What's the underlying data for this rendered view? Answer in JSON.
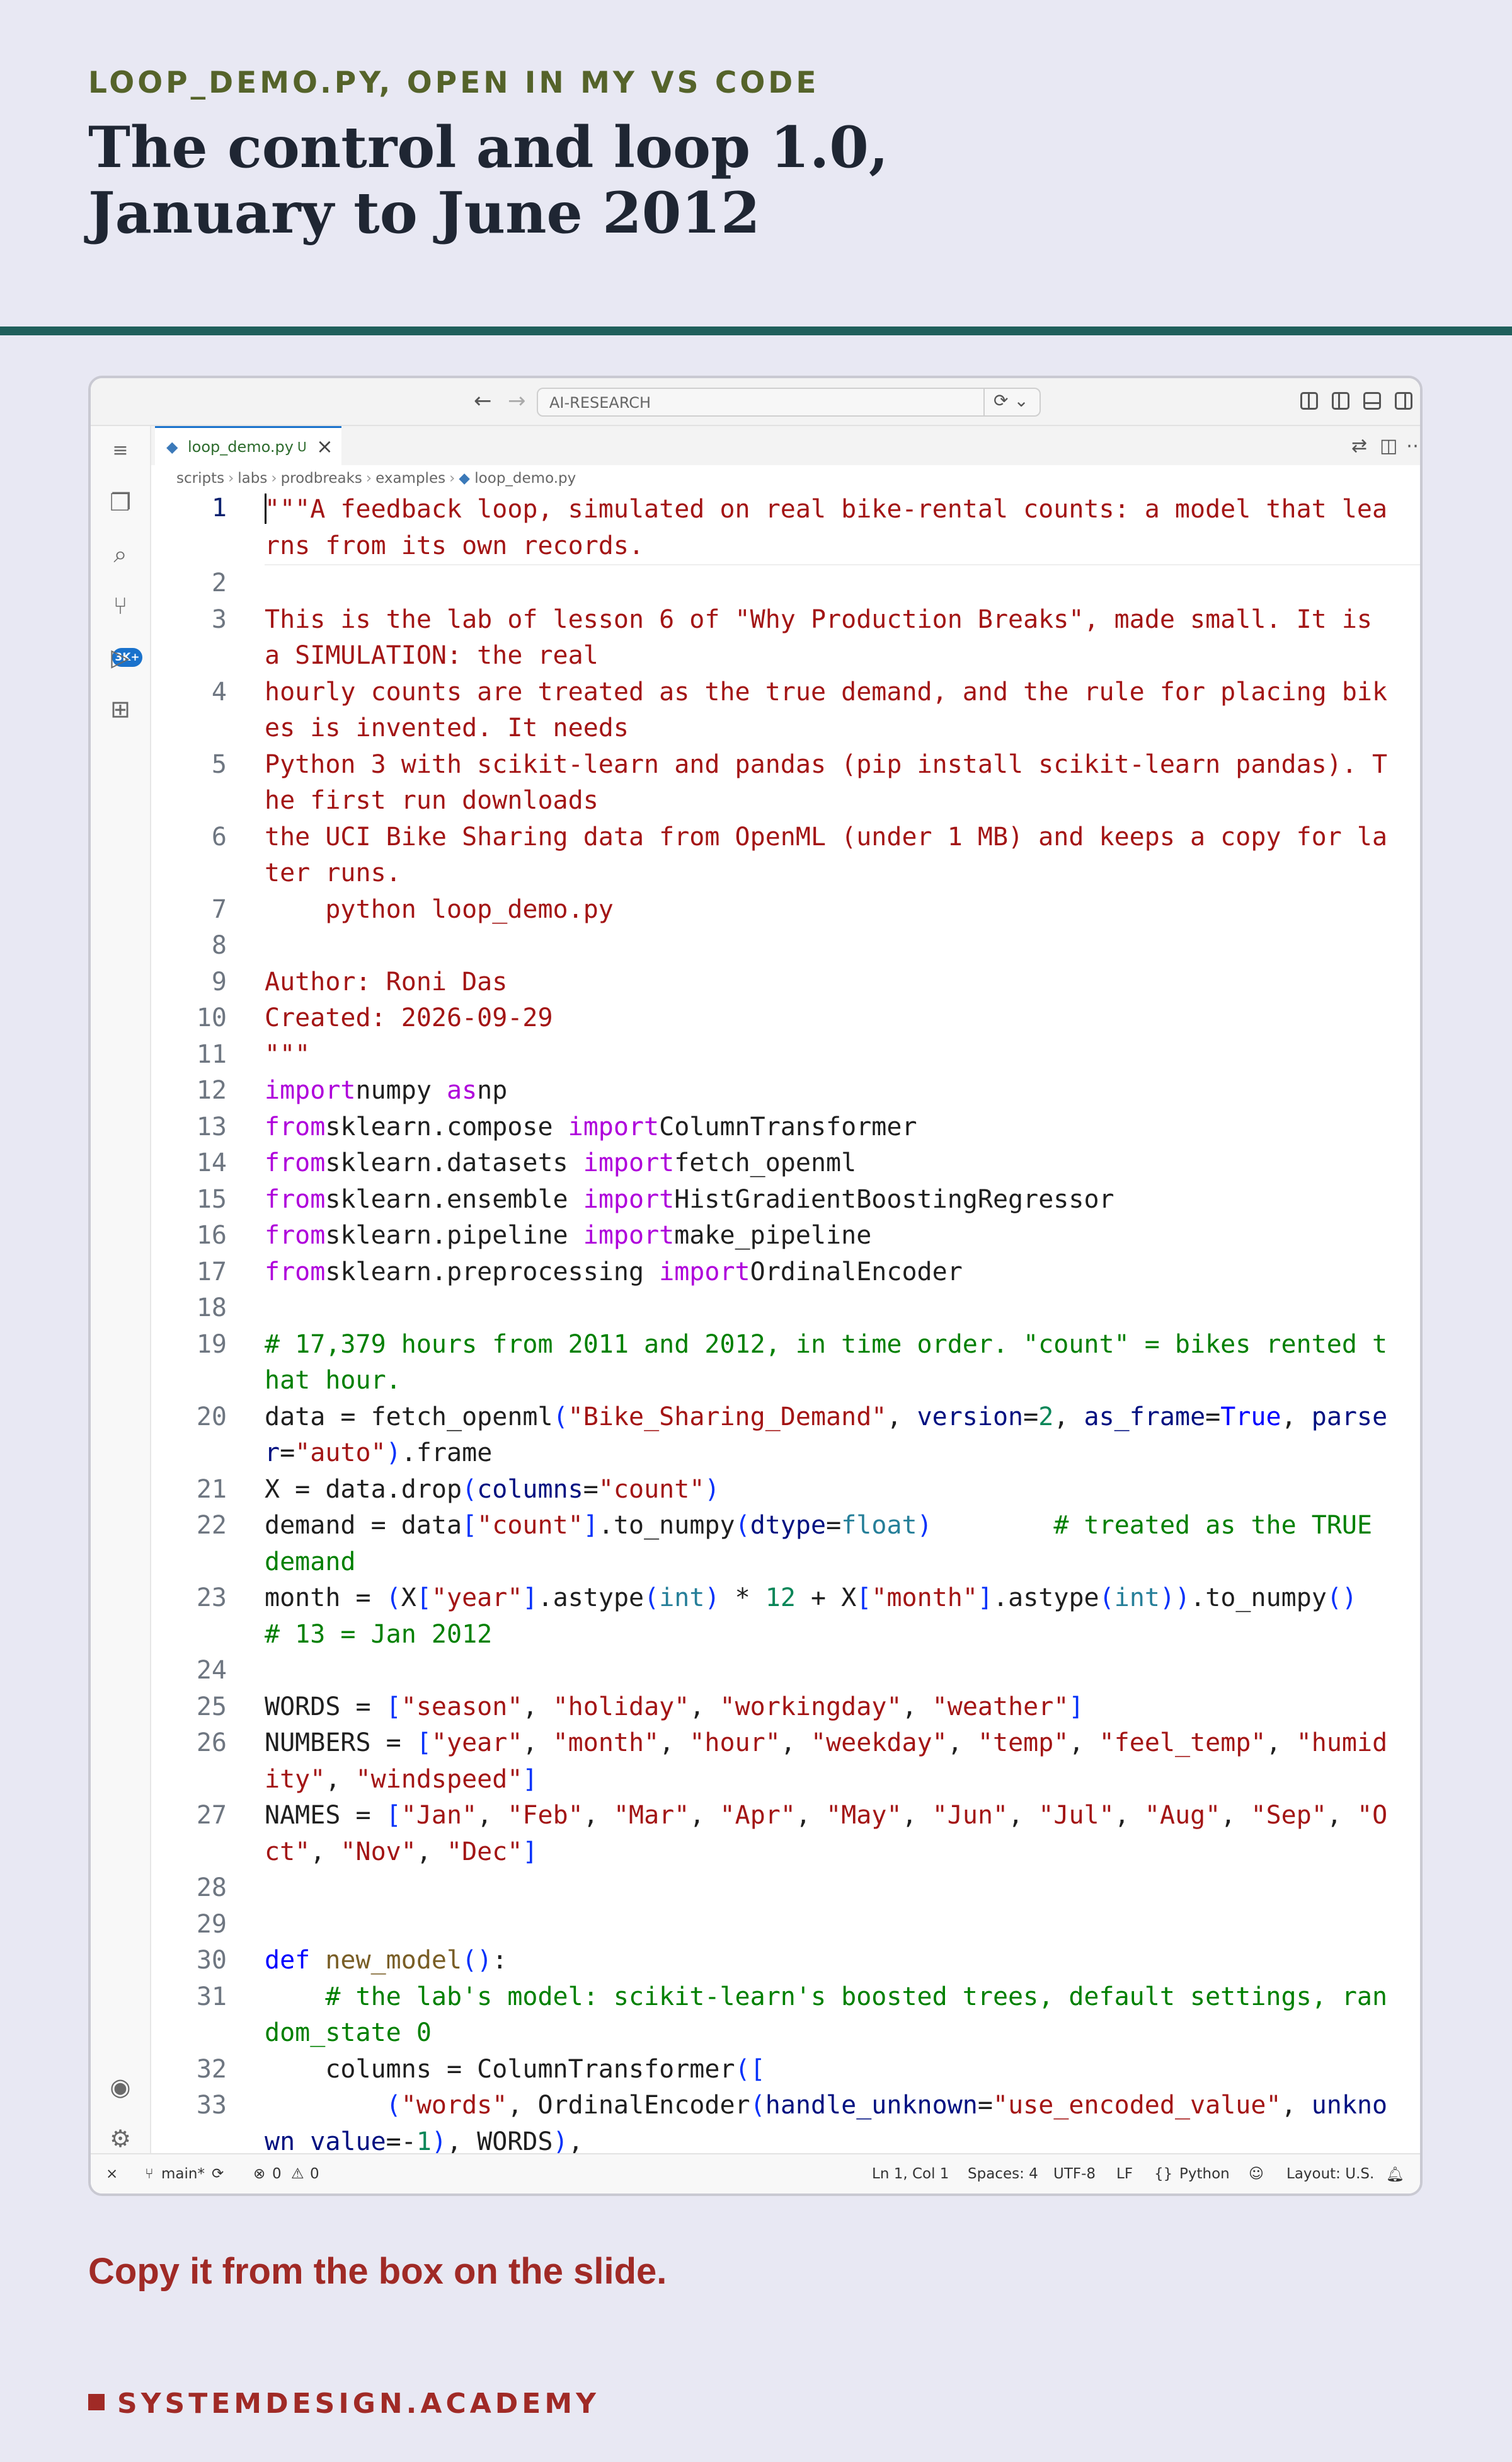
{
  "slide": {
    "kicker": "LOOP_DEMO.PY, OPEN IN MY VS CODE",
    "title_line1": "The control and loop 1.0,",
    "title_line2": "January to June 2012",
    "footer_note": "Copy it from the box on the slide.",
    "brand": "SYSTEMDESIGN.ACADEMY",
    "colors": {
      "kicker": "#55632a",
      "rule": "#1f5f5b",
      "accent": "#a02a26",
      "background": "#e8e8f3"
    }
  },
  "titlebar": {
    "search_label": "AI-RESEARCH",
    "back_icon": "arrow-left-icon",
    "forward_icon": "arrow-right-icon"
  },
  "tab": {
    "filename": "loop_demo.py",
    "status": "U"
  },
  "breadcrumb": [
    "scripts",
    "labs",
    "prodbreaks",
    "examples",
    "loop_demo.py"
  ],
  "activity_bar": {
    "badge": "3K+",
    "items": [
      "explorer-icon",
      "search-icon",
      "source-control-icon",
      "run-debug-icon",
      "extensions-icon",
      "account-icon",
      "settings-gear-icon"
    ]
  },
  "code": {
    "current_line": 1,
    "lines": [
      [
        [
          "str",
          "\"\"\"A feedback loop, simulated on real bike-rental counts: a model that learns from its own records."
        ]
      ],
      [],
      [
        [
          "str",
          "This is the lab of lesson 6 of \"Why Production Breaks\", made small. It is a SIMULATION: the real"
        ]
      ],
      [
        [
          "str",
          "hourly counts are treated as the true demand, and the rule for placing bikes is invented. It needs"
        ]
      ],
      [
        [
          "str",
          "Python 3 with scikit-learn and pandas (pip install scikit-learn pandas). The first run downloads"
        ]
      ],
      [
        [
          "str",
          "the UCI Bike Sharing data from OpenML (under 1 MB) and keeps a copy for later runs."
        ]
      ],
      [
        [
          "str",
          "    python loop_demo.py"
        ]
      ],
      [],
      [
        [
          "str",
          "Author: Roni Das"
        ]
      ],
      [
        [
          "str",
          "Created: 2026-09-29"
        ]
      ],
      [
        [
          "str",
          "\"\"\""
        ]
      ],
      [
        [
          "kw",
          "import"
        ],
        [
          "",
          "numpy "
        ],
        [
          "kw",
          "as"
        ],
        [
          "",
          "np"
        ]
      ],
      [
        [
          "kw",
          "from"
        ],
        [
          "",
          "sklearn.compose "
        ],
        [
          "kw",
          "import"
        ],
        [
          "",
          "ColumnTransformer"
        ]
      ],
      [
        [
          "kw",
          "from"
        ],
        [
          "",
          "sklearn.datasets "
        ],
        [
          "kw",
          "import"
        ],
        [
          "",
          "fetch_openml"
        ]
      ],
      [
        [
          "kw",
          "from"
        ],
        [
          "",
          "sklearn.ensemble "
        ],
        [
          "kw",
          "import"
        ],
        [
          "",
          "HistGradientBoostingRegressor"
        ]
      ],
      [
        [
          "kw",
          "from"
        ],
        [
          "",
          "sklearn.pipeline "
        ],
        [
          "kw",
          "import"
        ],
        [
          "",
          "make_pipeline"
        ]
      ],
      [
        [
          "kw",
          "from"
        ],
        [
          "",
          "sklearn.preprocessing "
        ],
        [
          "kw",
          "import"
        ],
        [
          "",
          "OrdinalEncoder"
        ]
      ],
      [],
      [
        [
          "cmt",
          "# 17,379 hours from 2011 and 2012, in time order. \"count\" = bikes rented that hour."
        ]
      ],
      [
        [
          "",
          "data = fetch_openml"
        ],
        [
          "bracket",
          "("
        ],
        [
          "str",
          "\"Bike_Sharing_Demand\""
        ],
        [
          "",
          ", "
        ],
        [
          "param",
          "version"
        ],
        [
          "",
          "="
        ],
        [
          "num",
          "2"
        ],
        [
          "",
          ", "
        ],
        [
          "param",
          "as_frame"
        ],
        [
          "",
          "="
        ],
        [
          "kw2",
          "True"
        ],
        [
          "",
          ", "
        ],
        [
          "param",
          "parser"
        ],
        [
          "",
          "="
        ],
        [
          "str",
          "\"auto\""
        ],
        [
          "bracket",
          ")"
        ],
        [
          "",
          ".frame"
        ]
      ],
      [
        [
          "",
          "X = data.drop"
        ],
        [
          "bracket",
          "("
        ],
        [
          "param",
          "columns"
        ],
        [
          "",
          "="
        ],
        [
          "str",
          "\"count\""
        ],
        [
          "bracket",
          ")"
        ]
      ],
      [
        [
          "",
          "demand = data"
        ],
        [
          "bracket",
          "["
        ],
        [
          "str",
          "\"count\""
        ],
        [
          "bracket",
          "]"
        ],
        [
          "",
          ".to_numpy"
        ],
        [
          "bracket",
          "("
        ],
        [
          "param",
          "dtype"
        ],
        [
          "",
          "="
        ],
        [
          "builtin",
          "float"
        ],
        [
          "bracket",
          ")"
        ],
        [
          "",
          "        "
        ],
        [
          "cmt",
          "# treated as the TRUE demand"
        ]
      ],
      [
        [
          "",
          "month = "
        ],
        [
          "bracket",
          "("
        ],
        [
          "",
          "X"
        ],
        [
          "bracket",
          "["
        ],
        [
          "str",
          "\"year\""
        ],
        [
          "bracket",
          "]"
        ],
        [
          "",
          ".astype"
        ],
        [
          "bracket",
          "("
        ],
        [
          "builtin",
          "int"
        ],
        [
          "bracket",
          ")"
        ],
        [
          "",
          " * "
        ],
        [
          "num",
          "12"
        ],
        [
          "",
          "",
          " + X"
        ],
        [
          "bracket",
          "["
        ],
        [
          "str",
          "\"month\""
        ],
        [
          "bracket",
          "]"
        ],
        [
          "",
          ".astype"
        ],
        [
          "bracket",
          "("
        ],
        [
          "builtin",
          "int"
        ],
        [
          "bracket",
          "))"
        ],
        [
          "",
          ".to_numpy"
        ],
        [
          "bracket",
          "()"
        ],
        [
          "",
          "  "
        ],
        [
          "cmt",
          "# 13 = Jan 2012"
        ]
      ],
      [],
      [
        [
          "",
          "WORDS = "
        ],
        [
          "bracket",
          "["
        ],
        [
          "str",
          "\"season\""
        ],
        [
          "",
          ", "
        ],
        [
          "str",
          "\"holiday\""
        ],
        [
          "",
          ", "
        ],
        [
          "str",
          "\"workingday\""
        ],
        [
          "",
          ", "
        ],
        [
          "str",
          "\"weather\""
        ],
        [
          "bracket",
          "]"
        ]
      ],
      [
        [
          "",
          "NUMBERS = "
        ],
        [
          "bracket",
          "["
        ],
        [
          "str",
          "\"year\""
        ],
        [
          "",
          ", "
        ],
        [
          "str",
          "\"month\""
        ],
        [
          "",
          ", "
        ],
        [
          "str",
          "\"hour\""
        ],
        [
          "",
          ", "
        ],
        [
          "str",
          "\"weekday\""
        ],
        [
          "",
          ", "
        ],
        [
          "str",
          "\"temp\""
        ],
        [
          "",
          ", "
        ],
        [
          "str",
          "\"feel_temp\""
        ],
        [
          "",
          ", "
        ],
        [
          "str",
          "\"humidity\""
        ],
        [
          "",
          ", "
        ],
        [
          "str",
          "\"windspeed\""
        ],
        [
          "bracket",
          "]"
        ]
      ],
      [
        [
          "",
          "NAMES = "
        ],
        [
          "bracket",
          "["
        ],
        [
          "str",
          "\"Jan\""
        ],
        [
          "",
          ", "
        ],
        [
          "str",
          "\"Feb\""
        ],
        [
          "",
          ", "
        ],
        [
          "str",
          "\"Mar\""
        ],
        [
          "",
          ", "
        ],
        [
          "str",
          "\"Apr\""
        ],
        [
          "",
          ", "
        ],
        [
          "str",
          "\"May\""
        ],
        [
          "",
          ", "
        ],
        [
          "str",
          "\"Jun\""
        ],
        [
          "",
          ", "
        ],
        [
          "str",
          "\"Jul\""
        ],
        [
          "",
          ", "
        ],
        [
          "str",
          "\"Aug\""
        ],
        [
          "",
          ", "
        ],
        [
          "str",
          "\"Sep\""
        ],
        [
          "",
          ", "
        ],
        [
          "str",
          "\"Oct\""
        ],
        [
          "",
          ", "
        ],
        [
          "str",
          "\"Nov\""
        ],
        [
          "",
          ", "
        ],
        [
          "str",
          "\"Dec\""
        ],
        [
          "bracket",
          "]"
        ]
      ],
      [],
      [],
      [
        [
          "kw2",
          "def"
        ],
        [
          "",
          "",
          " "
        ],
        [
          "fn",
          "new_model"
        ],
        [
          "bracket",
          "()"
        ],
        [
          "",
          ":"
        ]
      ],
      [
        [
          "",
          "    "
        ],
        [
          "cmt",
          "# the lab's model: scikit-learn's boosted trees, default settings, random_state 0"
        ]
      ],
      [
        [
          "",
          "    columns = ColumnTransformer"
        ],
        [
          "bracket",
          "(["
        ]
      ],
      [
        [
          "",
          "        "
        ],
        [
          "bracket",
          "("
        ],
        [
          "str",
          "\"words\""
        ],
        [
          "",
          ", OrdinalEncoder"
        ],
        [
          "bracket",
          "("
        ],
        [
          "param",
          "handle_unknown"
        ],
        [
          "",
          "="
        ],
        [
          "str",
          "\"use_encoded_value\""
        ],
        [
          "",
          ", "
        ],
        [
          "param",
          "unknown_value"
        ],
        [
          "",
          "=-"
        ],
        [
          "num",
          "1"
        ],
        [
          "bracket",
          ")"
        ],
        [
          "",
          ", WORDS"
        ],
        [
          "bracket",
          ")"
        ],
        [
          "",
          ","
        ]
      ]
    ]
  },
  "statusbar": {
    "branch": "main*",
    "errors": "0",
    "warnings": "0",
    "position": "Ln 1, Col 1",
    "spaces": "Spaces: 4",
    "encoding": "UTF-8",
    "eol": "LF",
    "language": "Python",
    "layout": "Layout: U.S."
  }
}
